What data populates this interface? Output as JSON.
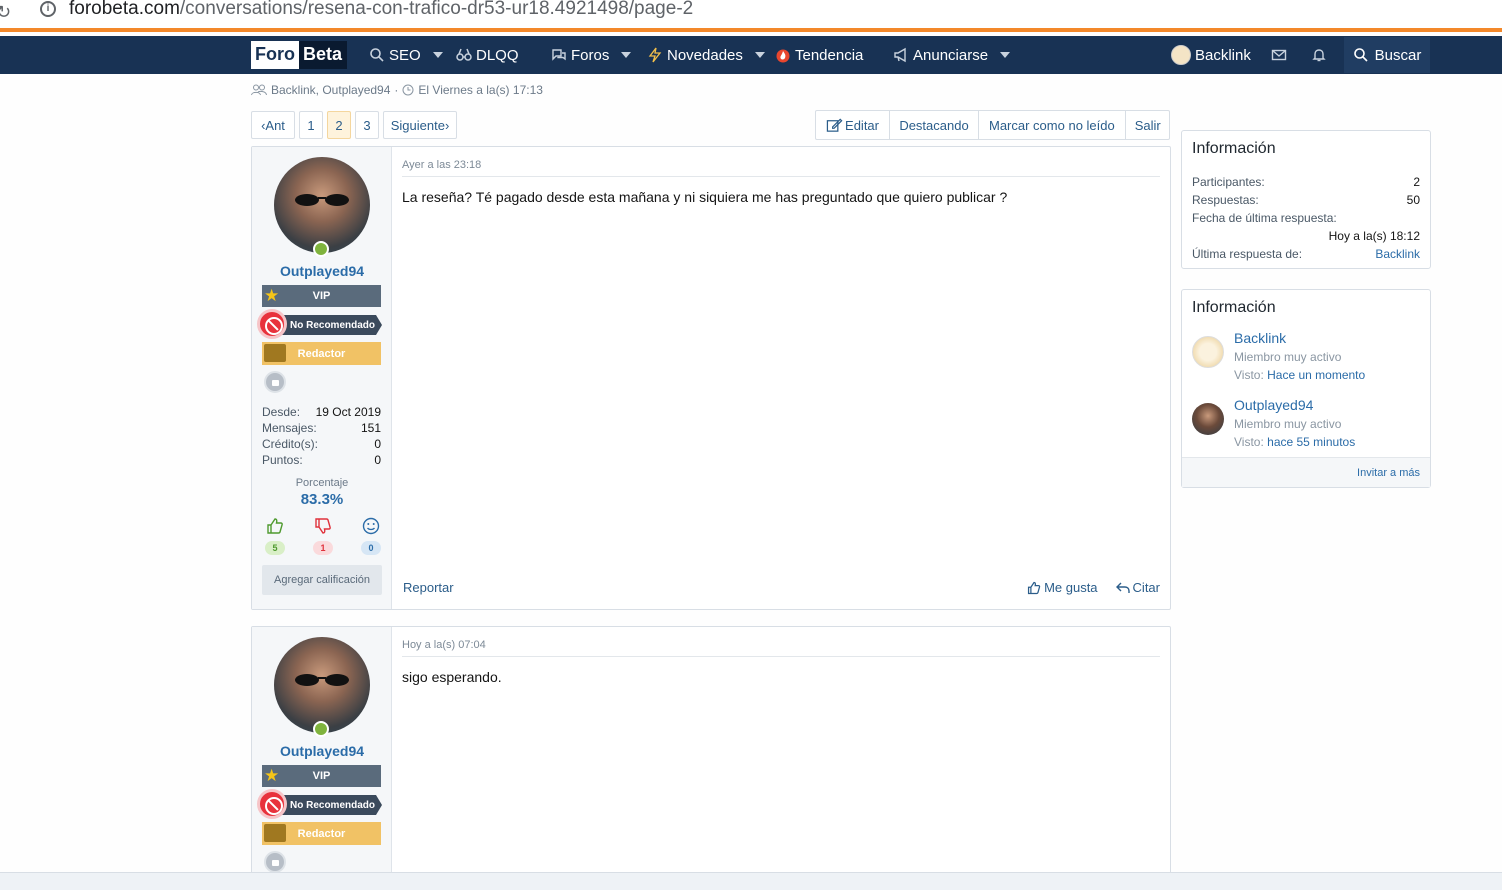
{
  "browser": {
    "url_host": "forobeta.com",
    "url_path": "/conversations/resena-con-trafico-dr53-ur18.4921498/page-2"
  },
  "nav": {
    "logo_a": "Foro",
    "logo_b": "Beta",
    "items": [
      {
        "label": "SEO",
        "icon": "search-icon"
      },
      {
        "label": "DLQQ",
        "icon": "binoculars-icon"
      },
      {
        "label": "Foros",
        "icon": "chat-icon"
      },
      {
        "label": "Novedades",
        "icon": "bolt-icon"
      },
      {
        "label": "Tendencia",
        "icon": "fire-icon"
      },
      {
        "label": "Anunciarse",
        "icon": "megaphone-icon"
      }
    ],
    "user": "Backlink",
    "search": "Buscar"
  },
  "meta": {
    "participants": "Backlink, Outplayed94",
    "sep": "·",
    "date": "El Viernes a la(s) 17:13"
  },
  "pager": {
    "prev": "Ant",
    "pages": [
      "1",
      "2",
      "3"
    ],
    "current": "2",
    "next": "Siguiente"
  },
  "actions": {
    "edit": "Editar",
    "feature": "Destacando",
    "unread": "Marcar como no leído",
    "leave": "Salir"
  },
  "posts": [
    {
      "user": "Outplayed94",
      "badges": {
        "vip": "VIP",
        "norec": "No Recomendado",
        "red": "Redactor"
      },
      "stats": [
        {
          "k": "Desde:",
          "v": "19 Oct 2019"
        },
        {
          "k": "Mensajes:",
          "v": "151"
        },
        {
          "k": "Crédito(s):",
          "v": "0"
        },
        {
          "k": "Puntos:",
          "v": "0"
        }
      ],
      "pct_label": "Porcentaje",
      "pct": "83.3%",
      "rates": [
        "5",
        "1",
        "0"
      ],
      "agregar": "Agregar calificación",
      "date": "Ayer a las 23:18",
      "body": "La reseña? Té pagado desde esta mañana y ni siquiera me has preguntado que quiero publicar ?",
      "report": "Reportar",
      "like": "Me gusta",
      "quote": "Citar"
    },
    {
      "user": "Outplayed94",
      "badges": {
        "vip": "VIP",
        "norec": "No Recomendado",
        "red": "Redactor"
      },
      "date": "Hoy a la(s) 07:04",
      "body": "sigo esperando."
    }
  ],
  "sidebar": {
    "info1": {
      "title": "Información",
      "rows": [
        {
          "k": "Participantes:",
          "v": "2"
        },
        {
          "k": "Respuestas:",
          "v": "50"
        },
        {
          "k": "Fecha de última respuesta:",
          "v": ""
        },
        {
          "k": "",
          "v": "Hoy a la(s) 18:12"
        },
        {
          "k": "Última respuesta de:",
          "v": "Backlink"
        }
      ]
    },
    "info2": {
      "title": "Información",
      "members": [
        {
          "name": "Backlink",
          "title": "Miembro muy activo",
          "seen_label": "Visto:",
          "seen": "Hace un momento"
        },
        {
          "name": "Outplayed94",
          "title": "Miembro muy activo",
          "seen_label": "Visto:",
          "seen": "hace 55 minutos"
        }
      ],
      "invite": "Invitar a más"
    }
  },
  "colors": {
    "nav": "#183254",
    "accent": "#f3882a",
    "link": "#2b6ca8"
  }
}
